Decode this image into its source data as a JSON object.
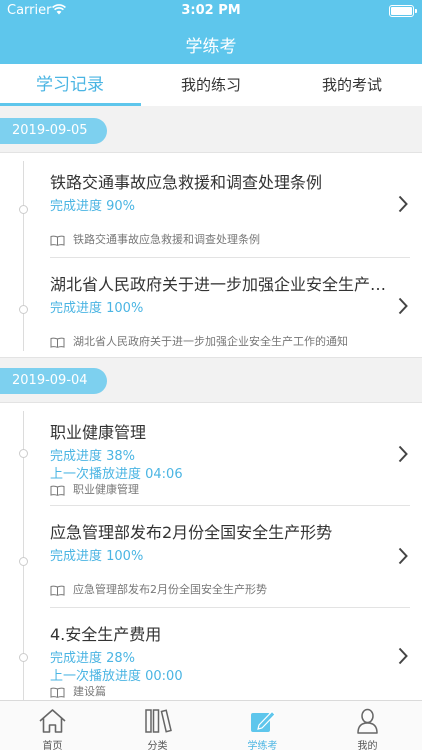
{
  "status_bar": {
    "carrier": "Carrier",
    "time": "3:02 PM"
  },
  "nav": {
    "title": "学练考"
  },
  "tabs": [
    {
      "label": "学习记录",
      "active": true
    },
    {
      "label": "我的练习",
      "active": false
    },
    {
      "label": "我的考试",
      "active": false
    }
  ],
  "groups": [
    {
      "date": "2019-09-05",
      "items": [
        {
          "title": "铁路交通事故应急救援和调查处理条例",
          "progress": "完成进度 90%",
          "source": "铁路交通事故应急救援和调查处理条例"
        },
        {
          "title": "湖北省人民政府关于进一步加强企业安全生产工作的通知",
          "progress": "完成进度 100%",
          "source": "湖北省人民政府关于进一步加强企业安全生产工作的通知"
        }
      ]
    },
    {
      "date": "2019-09-04",
      "items": [
        {
          "title": "职业健康管理",
          "progress": "完成进度 38%",
          "last_play": "上一次播放进度 04:06",
          "source": "职业健康管理"
        },
        {
          "title": "应急管理部发布2月份全国安全生产形势",
          "progress": "完成进度 100%",
          "source": "应急管理部发布2月份全国安全生产形势"
        },
        {
          "title": "4.安全生产费用",
          "progress": "完成进度 28%",
          "last_play": "上一次播放进度 00:00",
          "source": "建设篇"
        }
      ]
    }
  ],
  "tabbar": [
    {
      "label": "首页",
      "icon": "home-icon",
      "active": false
    },
    {
      "label": "分类",
      "icon": "category-icon",
      "active": false
    },
    {
      "label": "学练考",
      "icon": "edit-icon",
      "active": true
    },
    {
      "label": "我的",
      "icon": "profile-icon",
      "active": false
    }
  ],
  "colors": {
    "accent": "#5ec6ec",
    "progress_text": "#4bb5e3",
    "date_pill": "#7dd0ef"
  }
}
